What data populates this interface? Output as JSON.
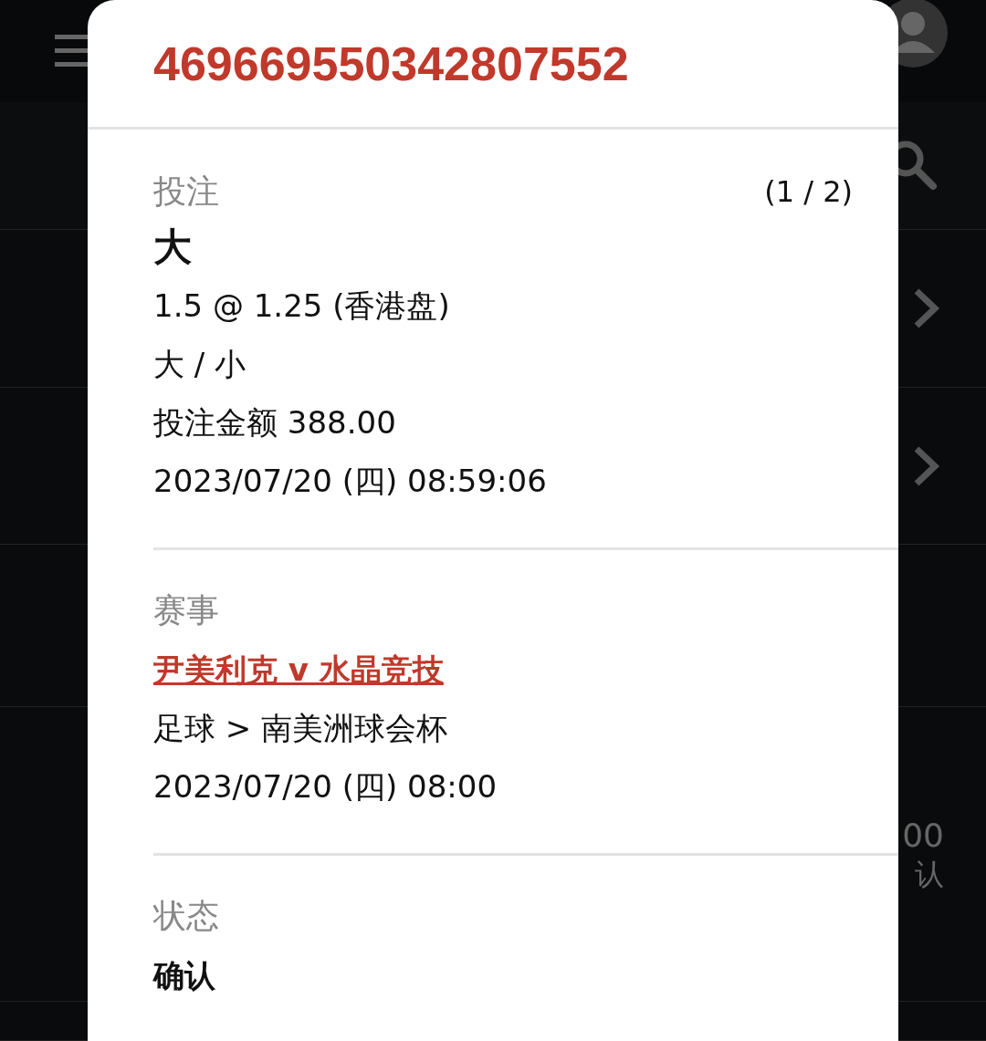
{
  "background": {
    "rows": [
      {
        "kind": "chevron"
      },
      {
        "kind": "chevron"
      },
      {
        "kind": "plain"
      },
      {
        "kind": "amount",
        "amount": "00",
        "status": "认"
      },
      {
        "kind": "plain"
      }
    ]
  },
  "dialog": {
    "title": "469669550342807552",
    "bet": {
      "label": "投注",
      "pager": "(1 / 2)",
      "selection": "大",
      "odds": "1.5 @ 1.25 (香港盘)",
      "market": "大 / 小",
      "stake": "投注金额 388.00",
      "placed": "2023/07/20 (四) 08:59:06"
    },
    "event": {
      "label": "赛事",
      "match": "尹美利克 v 水晶竞技",
      "competition": "足球 > 南美洲球会杯",
      "kickoff": "2023/07/20 (四) 08:00"
    },
    "status": {
      "label": "状态",
      "value": "确认"
    }
  }
}
